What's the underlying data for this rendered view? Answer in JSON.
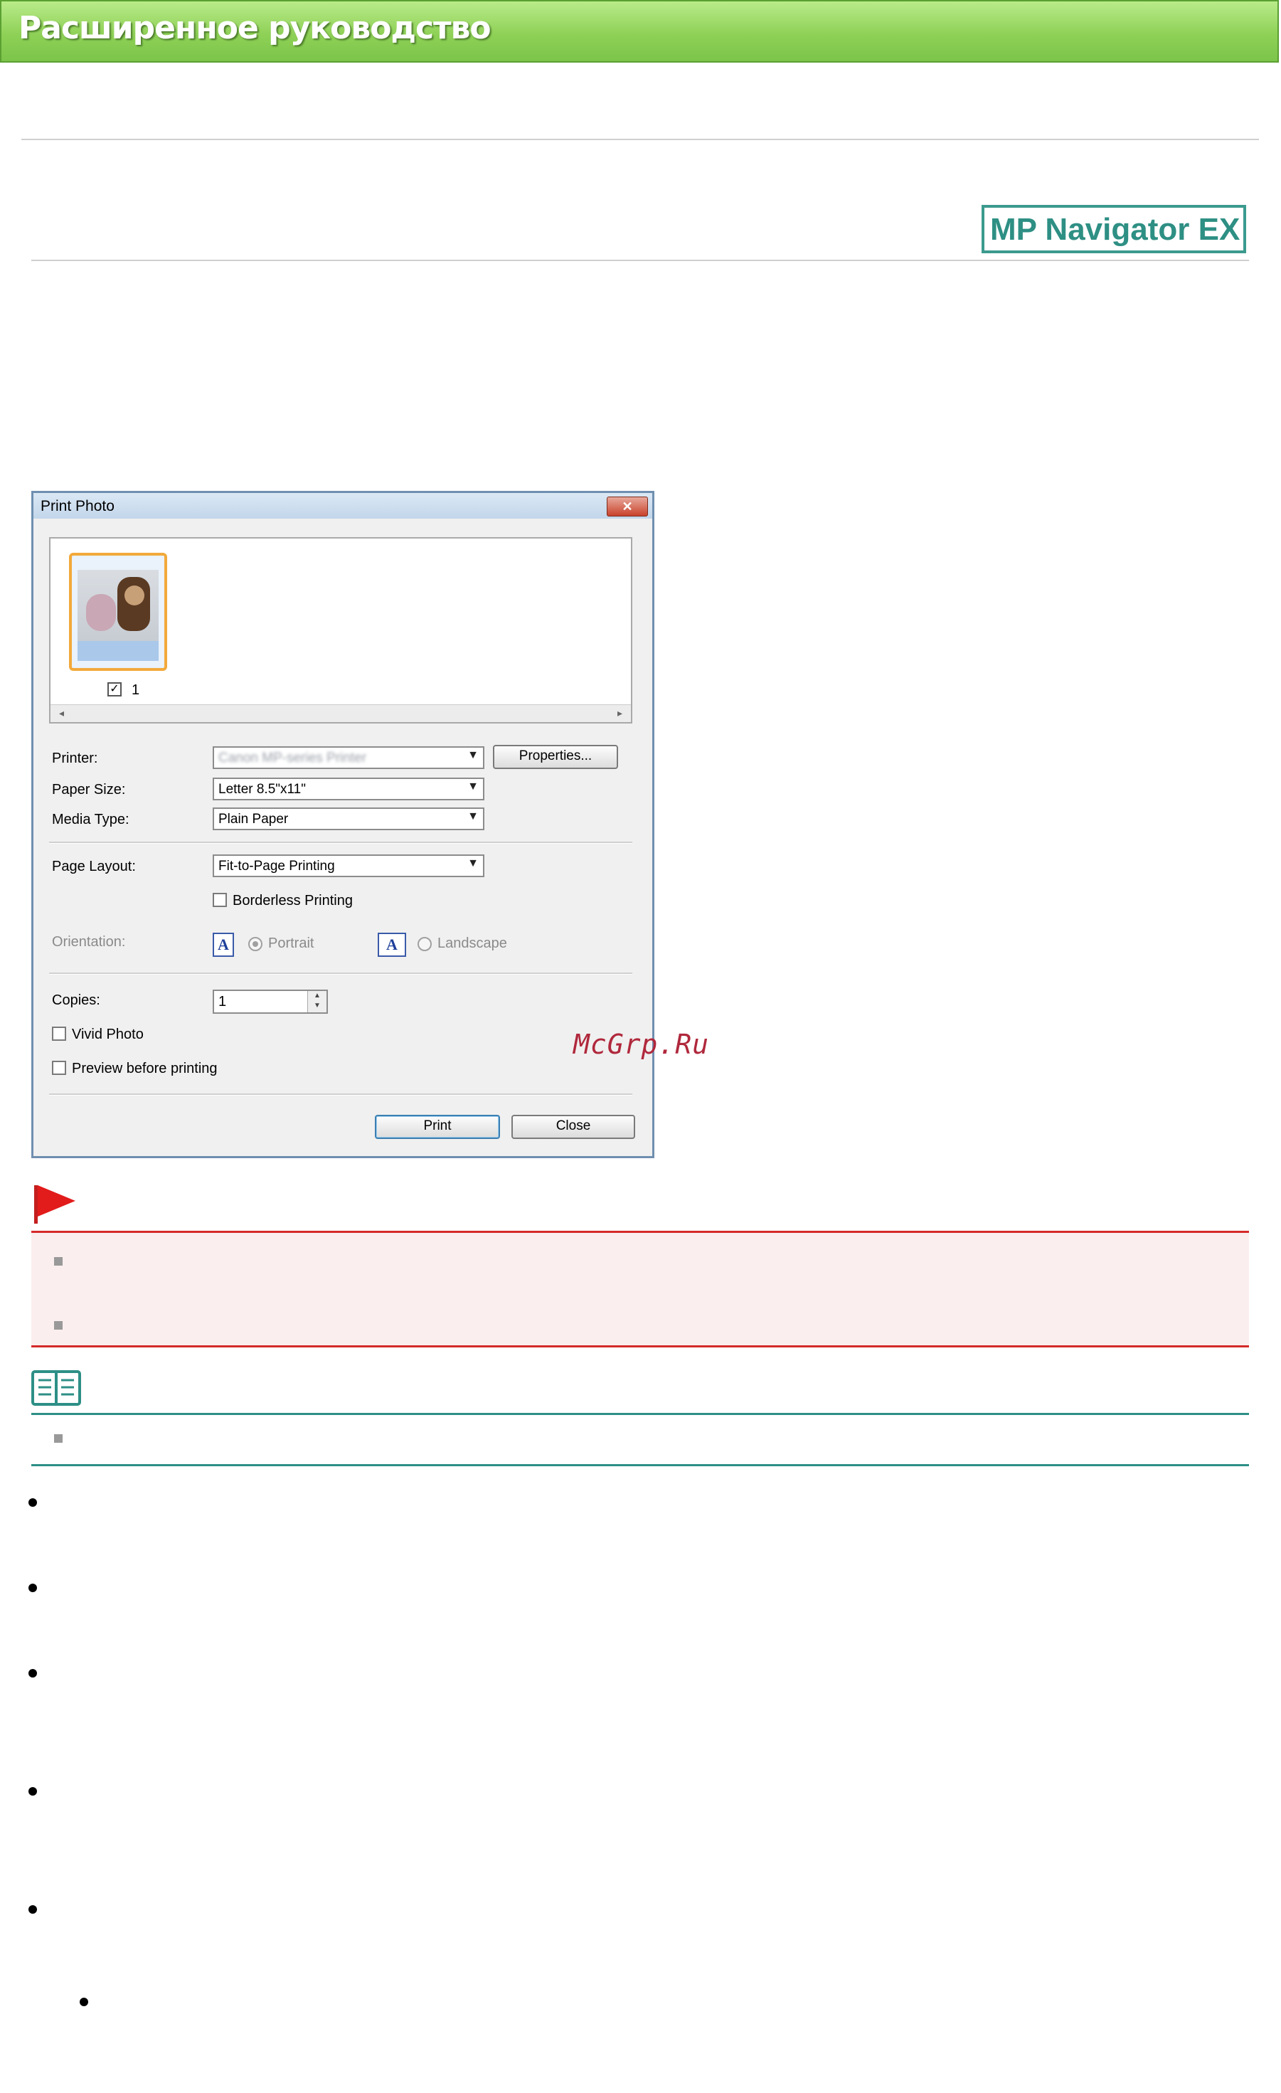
{
  "header": {
    "banner_title": "Расширенное руководство",
    "app_badge": "MP Navigator EX",
    "brand_green": "#8fd157",
    "badge_color": "#2e8f84"
  },
  "dialog": {
    "title": "Print Photo",
    "close_glyph": "✕",
    "thumbnail": {
      "checked": true,
      "check_glyph": "✓",
      "number": "1"
    },
    "scroll_left": "◂",
    "scroll_right": "▸",
    "printer_label": "Printer:",
    "printer_value": "Canon MP-series Printer",
    "properties_button": "Properties...",
    "paper_size_label": "Paper Size:",
    "paper_size_value": "Letter 8.5\"x11\"",
    "media_type_label": "Media Type:",
    "media_type_value": "Plain Paper",
    "page_layout_label": "Page Layout:",
    "page_layout_value": "Fit-to-Page Printing",
    "borderless_label": "Borderless Printing",
    "orientation_label": "Orientation:",
    "portrait_label": "Portrait",
    "landscape_label": "Landscape",
    "orientation_icon_letter": "A",
    "copies_label": "Copies:",
    "copies_value": "1",
    "vivid_label": "Vivid Photo",
    "preview_label": "Preview before printing",
    "print_button": "Print",
    "close_button": "Close",
    "dropdown_arrow": "▼",
    "spin_up": "▲",
    "spin_down": "▼"
  },
  "watermark": "McGrp.Ru",
  "important": {
    "accent": "#d42a2a",
    "background": "#fbeeee"
  },
  "note": {
    "accent": "#2d8f86"
  }
}
